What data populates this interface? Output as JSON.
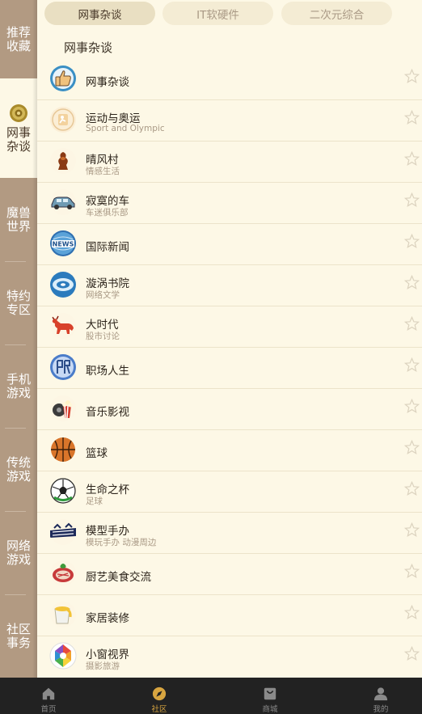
{
  "sidebar": {
    "items": [
      {
        "label": "推荐收藏",
        "active": false
      },
      {
        "label": "网事杂谈",
        "active": true,
        "icon": "sphere-icon"
      },
      {
        "label": "魔兽世界",
        "active": false
      },
      {
        "label": "特约专区",
        "active": false
      },
      {
        "label": "手机游戏",
        "active": false
      },
      {
        "label": "传统游戏",
        "active": false
      },
      {
        "label": "网络游戏",
        "active": false
      },
      {
        "label": "社区事务",
        "active": false
      }
    ]
  },
  "tabs": [
    {
      "label": "网事杂谈",
      "active": true
    },
    {
      "label": "IT软硬件",
      "active": false
    },
    {
      "label": "二次元综合",
      "active": false
    }
  ],
  "section_title": "网事杂谈",
  "forums": [
    {
      "name": "网事杂谈",
      "desc": "",
      "icon": "thumbs-up-icon"
    },
    {
      "name": "运动与奥运",
      "desc": "Sport and Olympic",
      "icon": "sport-icon"
    },
    {
      "name": "晴风村",
      "desc": "情感生活",
      "icon": "vase-icon"
    },
    {
      "name": "寂寞的车",
      "desc": "车迷俱乐部",
      "icon": "car-icon"
    },
    {
      "name": "国际新闻",
      "desc": "",
      "icon": "news-globe-icon"
    },
    {
      "name": "漩涡书院",
      "desc": "网络文学",
      "icon": "book-icon"
    },
    {
      "name": "大时代",
      "desc": "股市讨论",
      "icon": "bull-icon"
    },
    {
      "name": "职场人生",
      "desc": "",
      "icon": "career-icon"
    },
    {
      "name": "音乐影视",
      "desc": "",
      "icon": "popcorn-icon"
    },
    {
      "name": "篮球",
      "desc": "",
      "icon": "basketball-icon"
    },
    {
      "name": "生命之杯",
      "desc": "足球",
      "icon": "soccer-ball-icon"
    },
    {
      "name": "模型手办",
      "desc": "模玩手办 动漫周边",
      "icon": "toy-logo-icon"
    },
    {
      "name": "厨艺美食交流",
      "desc": "",
      "icon": "food-icon"
    },
    {
      "name": "家居装修",
      "desc": "",
      "icon": "paint-bucket-icon"
    },
    {
      "name": "小窗视界",
      "desc": "摄影旅游",
      "icon": "aperture-icon"
    }
  ],
  "bottom_nav": [
    {
      "label": "首页",
      "icon": "home-icon",
      "active": false
    },
    {
      "label": "社区",
      "icon": "compass-icon",
      "active": true
    },
    {
      "label": "商城",
      "icon": "bag-icon",
      "active": false
    },
    {
      "label": "我的",
      "icon": "person-icon",
      "active": false
    }
  ],
  "colors": {
    "background": "#fdf8e6",
    "sidebar": "#b29a82",
    "active_tab": "#e9dfc2",
    "bottom_bar": "#222222",
    "accent": "#d8a540"
  }
}
